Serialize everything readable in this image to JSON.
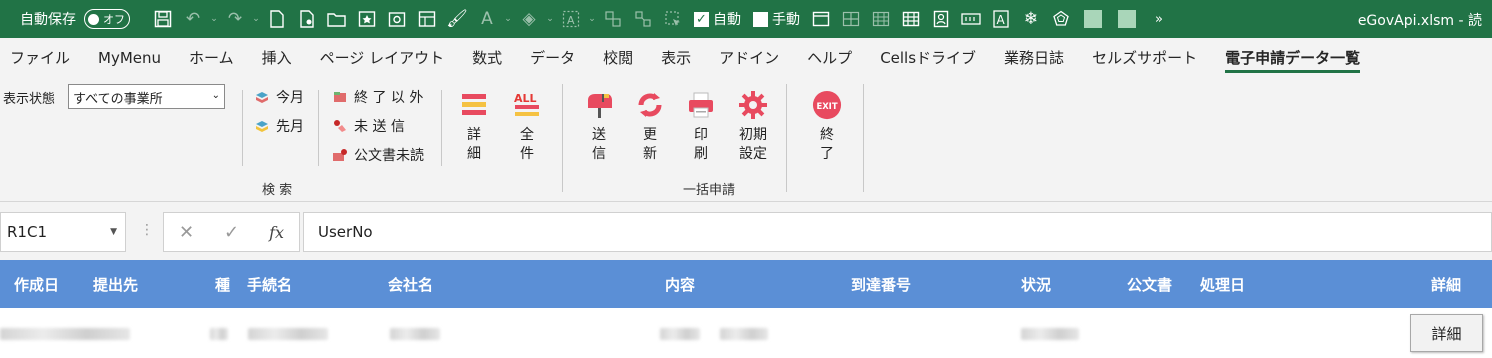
{
  "titlebar": {
    "autosave_label": "自動保存",
    "autosave_state": "オフ",
    "check_auto": "自動",
    "check_manual": "手動",
    "more": "»",
    "file_title": "eGovApi.xlsm  -  読"
  },
  "tabs": [
    "ファイル",
    "MyMenu",
    "ホーム",
    "挿入",
    "ページ レイアウト",
    "数式",
    "データ",
    "校閲",
    "表示",
    "アドイン",
    "ヘルプ",
    "Cellsドライブ",
    "業務日誌",
    "セルズサポート",
    "電子申請データ一覧"
  ],
  "ribbon": {
    "display_label": "表示状態",
    "display_value": "すべての事業所",
    "this_month": "今月",
    "last_month": "先月",
    "except_done": "終 了 以 外",
    "unsent": "未 送 信",
    "unread_docs": "公文書未読",
    "detail": "詳\n細",
    "all": "全\n件",
    "all_icon_text": "ALL",
    "search_group": "検 索",
    "send": "送\n信",
    "update": "更\n新",
    "print": "印\n刷",
    "init": "初期\n設定",
    "bulk_group": "一括申請",
    "exit": "終\n了",
    "exit_icon_text": "EXIT"
  },
  "formula_bar": {
    "name_box": "R1C1",
    "cancel": "✕",
    "enter": "✓",
    "fx": "fx",
    "content": "UserNo"
  },
  "sheet": {
    "headers": {
      "created": "作成日",
      "submit_to": "提出先",
      "type": "種",
      "procedure": "手続名",
      "company": "会社名",
      "content": "内容",
      "arrival_no": "到達番号",
      "status": "状況",
      "official_doc": "公文書",
      "processed": "処理日",
      "detail": "詳細"
    },
    "row_button": "詳細"
  }
}
